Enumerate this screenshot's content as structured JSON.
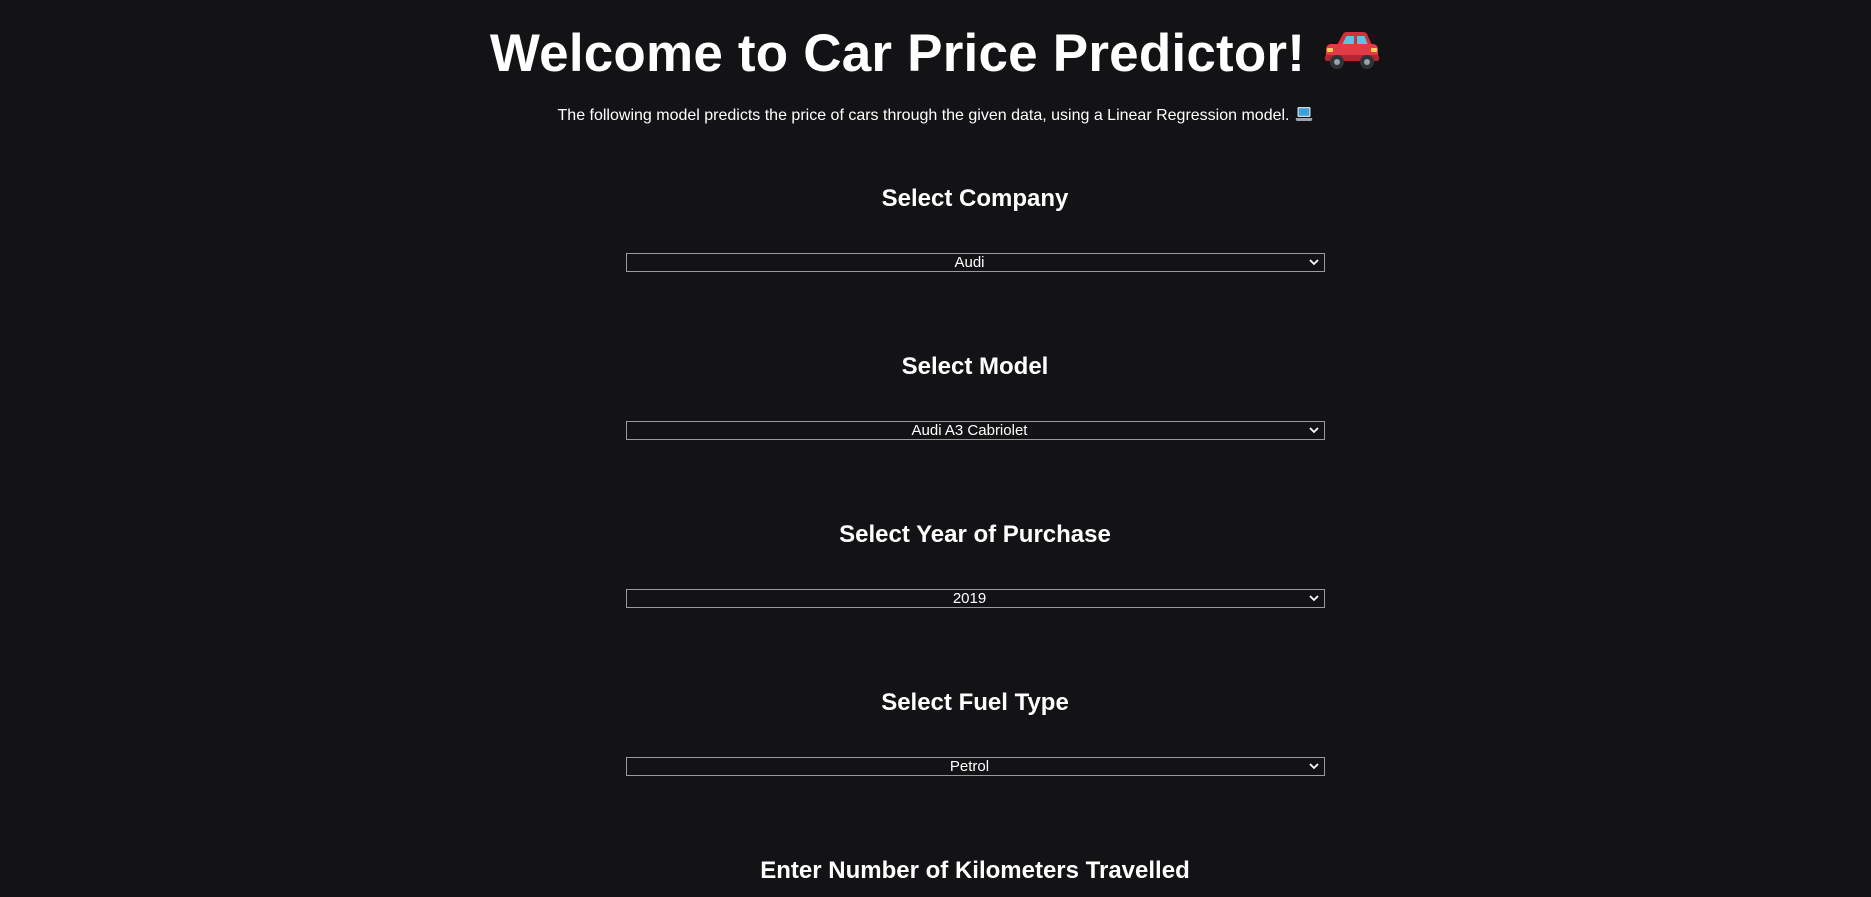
{
  "header": {
    "title": "Welcome to Car Price Predictor!",
    "title_icon": "red-car-icon",
    "subtitle": "The following model predicts the price of cars through the given data, using a Linear Regression model.",
    "subtitle_icon": "laptop-icon"
  },
  "form": {
    "company": {
      "label": "Select Company",
      "value": "Audi"
    },
    "model": {
      "label": "Select Model",
      "value": "Audi A3 Cabriolet"
    },
    "year": {
      "label": "Select Year of Purchase",
      "value": "2019"
    },
    "fuel": {
      "label": "Select Fuel Type",
      "value": "Petrol"
    },
    "kilometers": {
      "label": "Enter Number of Kilometers Travelled"
    }
  },
  "colors": {
    "background": "#131316",
    "text": "#ffffff",
    "select_border": "#9a9a9a"
  }
}
